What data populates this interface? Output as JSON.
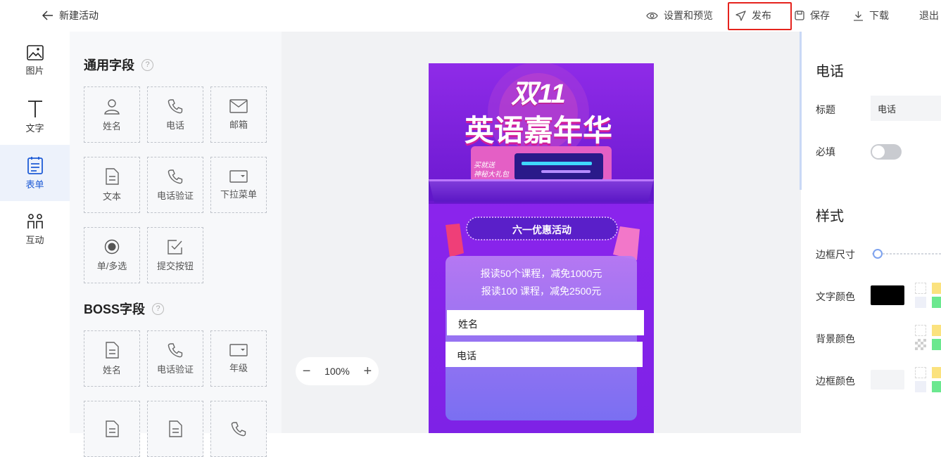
{
  "header": {
    "back_label": "新建活动",
    "actions": [
      {
        "label": "设置和预览",
        "icon": "eye-icon"
      },
      {
        "label": "发布",
        "icon": "send-icon"
      },
      {
        "label": "保存",
        "icon": "save-icon"
      },
      {
        "label": "下载",
        "icon": "download-icon"
      },
      {
        "label": "退出",
        "icon": ""
      }
    ]
  },
  "rail": {
    "items": [
      {
        "label": "图片",
        "icon": "image-icon"
      },
      {
        "label": "文字",
        "icon": "text-icon"
      },
      {
        "label": "表单",
        "icon": "form-icon",
        "active": true
      },
      {
        "label": "互动",
        "icon": "interaction-icon"
      }
    ]
  },
  "panel": {
    "general_title": "通用字段",
    "general_fields": [
      "姓名",
      "电话",
      "邮箱",
      "文本",
      "电话验证",
      "下拉菜单",
      "单/多选",
      "提交按钮"
    ],
    "boss_title": "BOSS字段",
    "boss_fields": [
      "姓名",
      "电话验证",
      "年级"
    ],
    "help_glyph": "?"
  },
  "canvas": {
    "zoom_value": "100%",
    "poster": {
      "headline_top": "双11",
      "headline_main": "英语嘉年华",
      "badge_line1": "买就送",
      "badge_line2": "神秘大礼包",
      "ribbon": "六一优惠活动",
      "promo_line1": "报读50个课程，减免1000元",
      "promo_line2": "报读100 课程，减免2500元",
      "field_name": "姓名",
      "field_phone": "电话"
    }
  },
  "props": {
    "field_title": "电话",
    "label_title": "标题",
    "title_value": "电话",
    "label_required": "必填",
    "required": false,
    "style_title": "样式",
    "label_border_size": "边框尺寸",
    "border_size_value": 0,
    "label_text_color": "文字颜色",
    "text_color": "#000000",
    "label_bg_color": "背景颜色",
    "bg_color": "#ffffff",
    "label_border_color": "边框颜色",
    "border_color": "#f3f4f6",
    "accent": "#1f5cd6"
  }
}
